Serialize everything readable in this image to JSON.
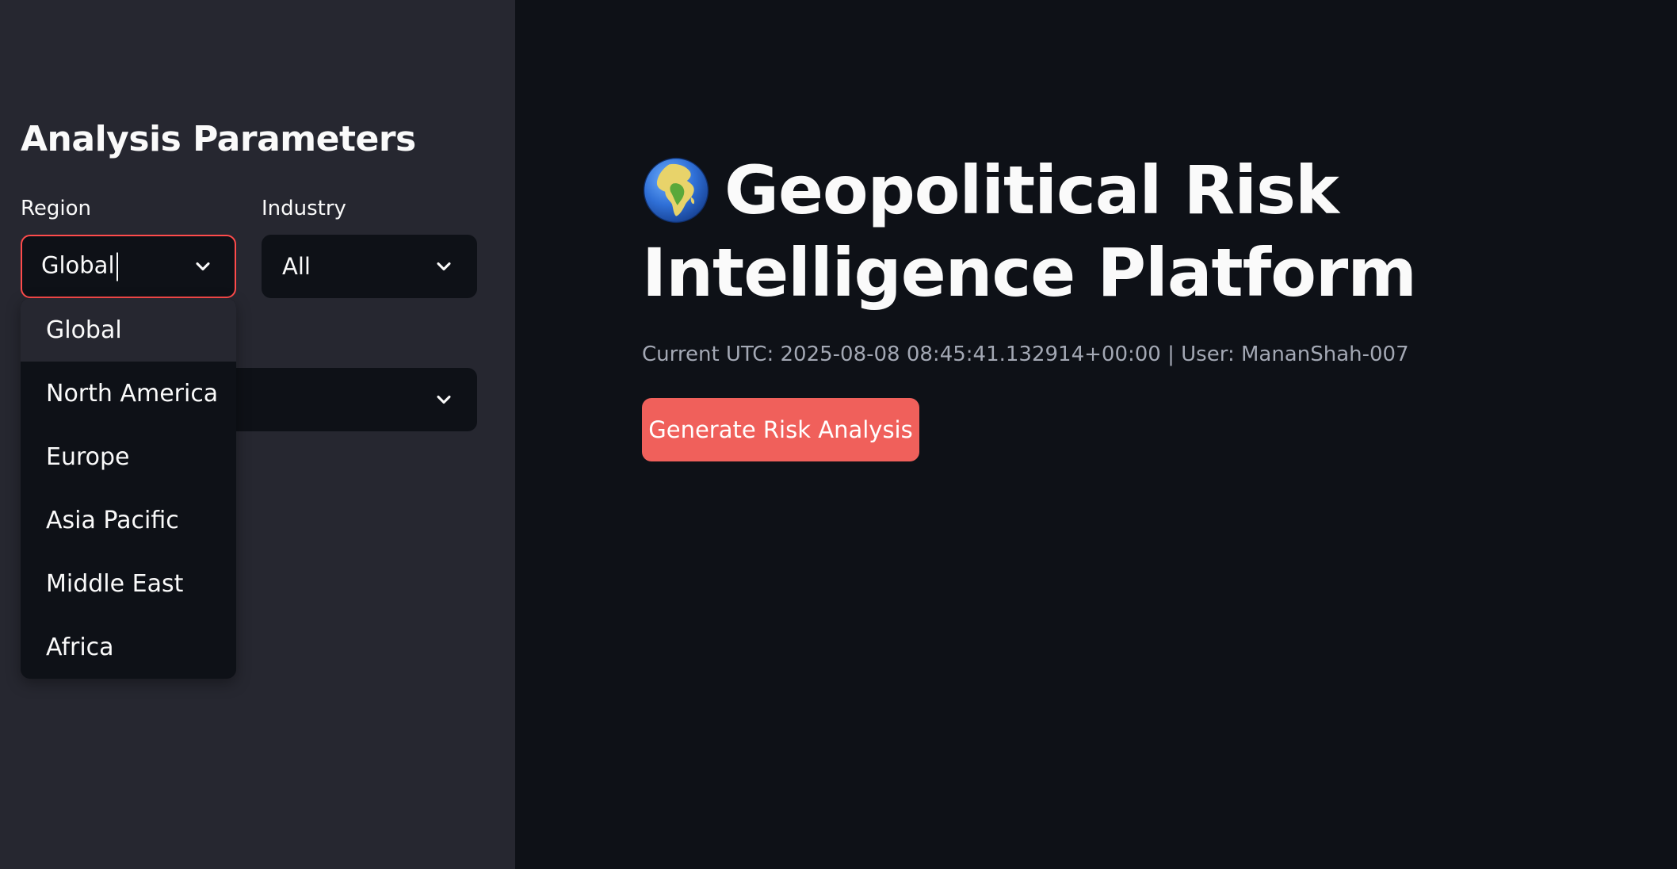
{
  "sidebar": {
    "title": "Analysis Parameters",
    "region": {
      "label": "Region",
      "value": "Global",
      "options": [
        "Global",
        "North America",
        "Europe",
        "Asia Pacific",
        "Middle East",
        "Africa"
      ]
    },
    "industry": {
      "label": "Industry",
      "value": "All"
    },
    "third_select": {
      "value": ""
    }
  },
  "main": {
    "title": "Geopolitical Risk Intelligence Platform",
    "title_icon": "globe-africa-icon",
    "status": "Current UTC: 2025-08-08 08:45:41.132914+00:00 | User: MananShah-007",
    "generate_label": "Generate Risk Analysis"
  },
  "colors": {
    "app_background": "#0e1117",
    "sidebar_background": "#262730",
    "accent": "#ff4b4b",
    "button": "#f0605b"
  }
}
